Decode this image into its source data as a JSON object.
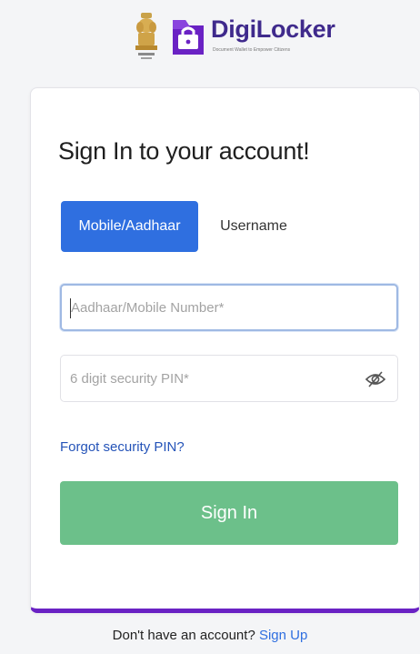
{
  "header": {
    "brand_name": "DigiLocker",
    "tagline": "Document Wallet to Empower Citizens",
    "brand_color": "#3f2a8c",
    "emblem_icon": "national-emblem-icon",
    "logo_icon": "digilocker-logo-icon"
  },
  "signin_card": {
    "title": "Sign In to your account!",
    "tabs": [
      {
        "label": "Mobile/Aadhaar",
        "active": true
      },
      {
        "label": "Username",
        "active": false
      }
    ],
    "mobile_field": {
      "placeholder": "Aadhaar/Mobile Number*",
      "value": ""
    },
    "pin_field": {
      "placeholder": "6 digit security PIN*",
      "value": "",
      "toggle_icon": "eye-slash-icon"
    },
    "forgot_link": "Forgot security PIN?",
    "signin_button": "Sign In",
    "colors": {
      "tab_active": "#2f6fe0",
      "signin_button": "#6cc08a",
      "card_accent": "#6a22c4",
      "link": "#2453b8"
    }
  },
  "footer": {
    "prompt": "Don't have an account?",
    "signup_link": "Sign Up"
  }
}
